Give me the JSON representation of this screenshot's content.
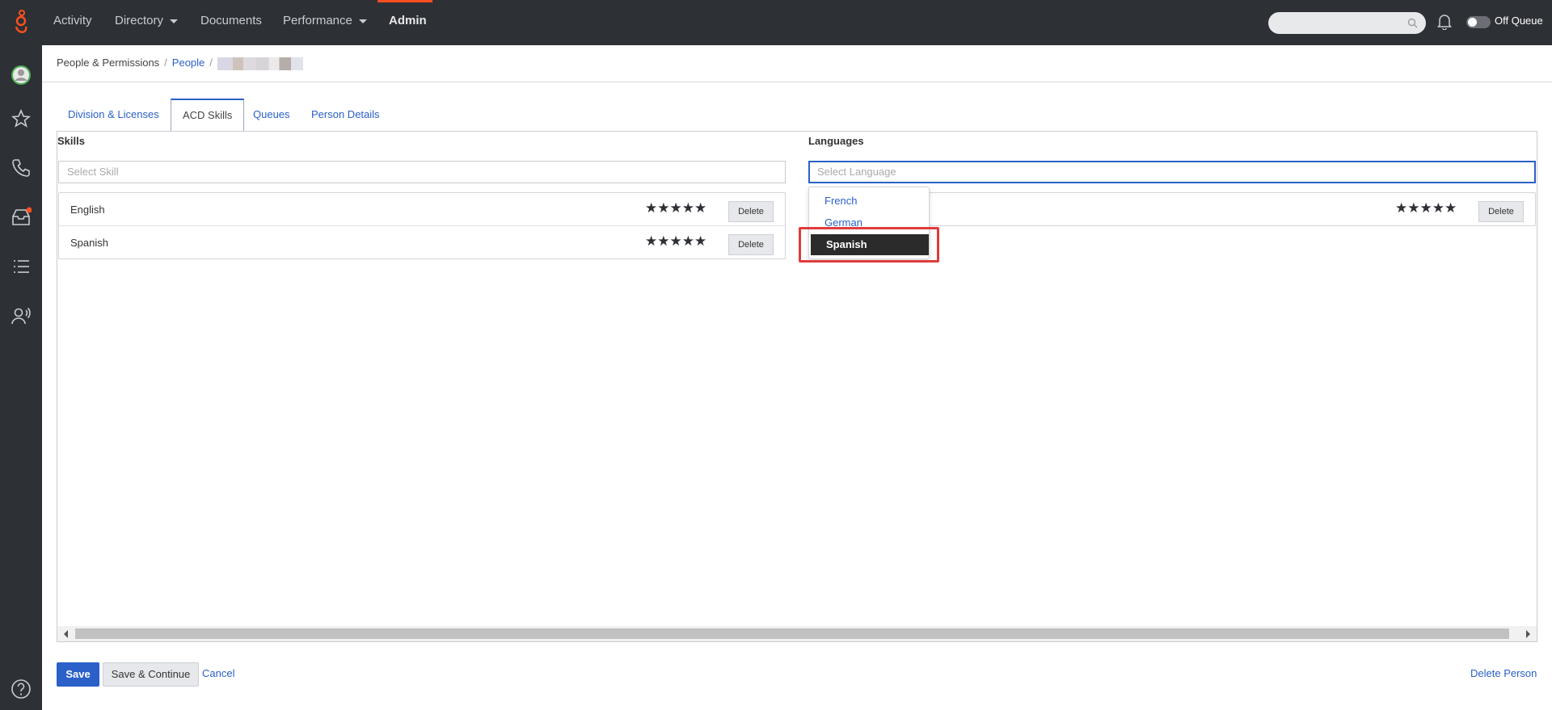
{
  "topnav": {
    "items": [
      {
        "label": "Activity"
      },
      {
        "label": "Directory"
      },
      {
        "label": "Documents"
      },
      {
        "label": "Performance"
      },
      {
        "label": "Admin"
      }
    ],
    "status_label": "Off Queue"
  },
  "breadcrumb": {
    "root": "People & Permissions",
    "people": "People",
    "separator": "/"
  },
  "tabs": [
    {
      "label": "Division & Licenses"
    },
    {
      "label": "ACD Skills"
    },
    {
      "label": "Queues"
    },
    {
      "label": "Person Details"
    }
  ],
  "skills": {
    "title": "Skills",
    "placeholder": "Select Skill",
    "rows": [
      {
        "name": "English",
        "stars": "★★★★★",
        "delete_label": "Delete"
      },
      {
        "name": "Spanish",
        "stars": "★★★★★",
        "delete_label": "Delete"
      }
    ]
  },
  "languages": {
    "title": "Languages",
    "placeholder": "Select Language",
    "rows": [
      {
        "stars": "★★★★★",
        "delete_label": "Delete"
      }
    ],
    "dropdown_options": [
      "French",
      "German",
      "Spanish"
    ],
    "dropdown_selected": "Spanish"
  },
  "footer": {
    "save": "Save",
    "save_continue": "Save & Continue",
    "cancel": "Cancel",
    "delete_person": "Delete Person"
  },
  "colors": {
    "topbar_bg": "#2d3035",
    "accent": "#2a60c8",
    "active_nav_bar": "#ff4f1f",
    "highlight_border": "#e03c3c"
  }
}
